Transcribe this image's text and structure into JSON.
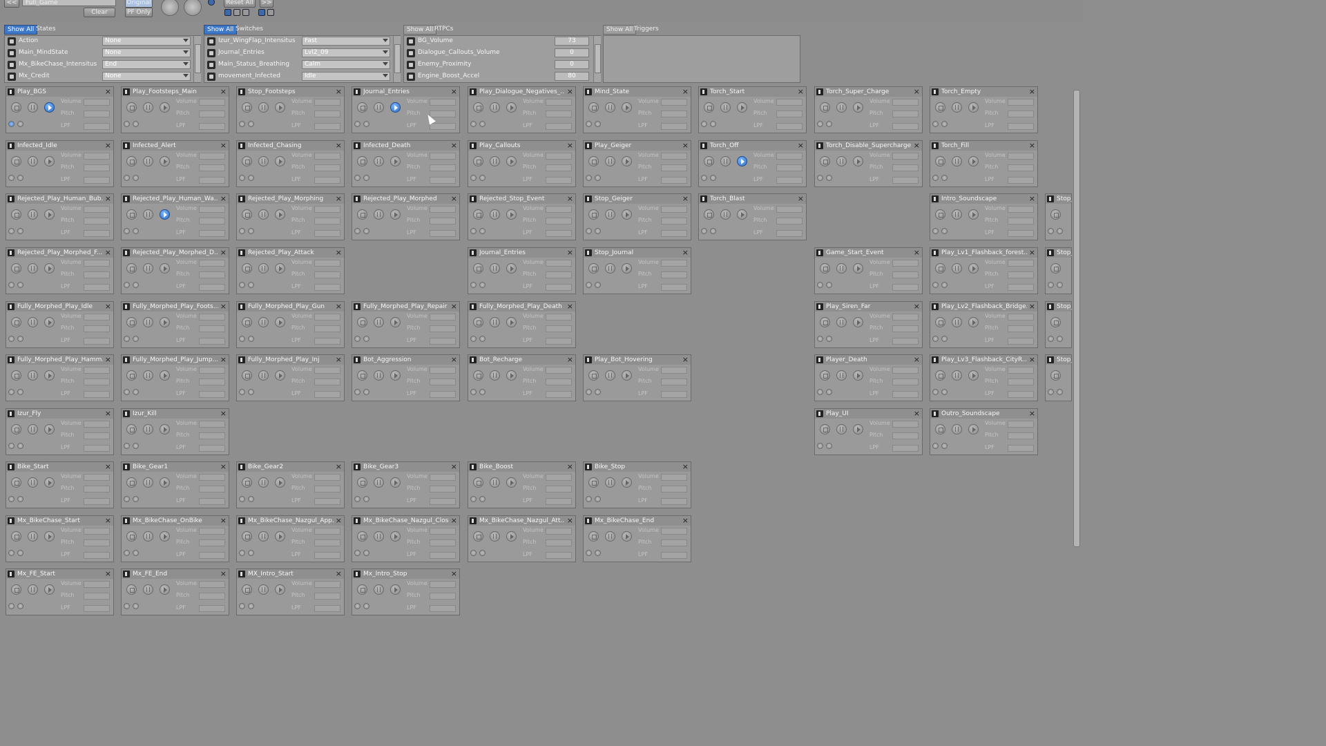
{
  "topbar": {
    "search_value": "Full_Game",
    "clear_label": "Clear",
    "original_label": "Original",
    "pf_only_label": "PF Only",
    "reset_all_label": "Reset All",
    "forward_label": ">>",
    "back_label": "<<"
  },
  "panels": [
    {
      "showall": "Show All",
      "tab": "States",
      "rows": [
        {
          "name": "Action",
          "value": "None"
        },
        {
          "name": "Main_MindState",
          "value": "None"
        },
        {
          "name": "Mx_BikeChase_Intensitus",
          "value": "End"
        },
        {
          "name": "Mx_Credit",
          "value": "None"
        }
      ]
    },
    {
      "showall": "Show All",
      "tab": "Switches",
      "rows": [
        {
          "name": "Izur_WingFlap_Intensitus",
          "value": "Fast"
        },
        {
          "name": "Journal_Entries",
          "value": "Lvl2_09"
        },
        {
          "name": "Main_Status_Breathing",
          "value": "Calm"
        },
        {
          "name": "movement_Infected",
          "value": "Idle"
        }
      ]
    },
    {
      "showall": "Show All",
      "tab": "RTPCs",
      "rows": [
        {
          "name": "BG_Volume",
          "value": "73"
        },
        {
          "name": "Dialogue_Callouts_Volume",
          "value": "0"
        },
        {
          "name": "Enemy_Proximity",
          "value": "0"
        },
        {
          "name": "Engine_Boost_Accel",
          "value": "80"
        }
      ]
    },
    {
      "showall": "Show All",
      "tab": "Triggers",
      "rows": []
    }
  ],
  "card_labels": {
    "volume": "Volume",
    "pitch": "Pitch",
    "lpf": "LPF"
  },
  "cards": [
    {
      "title": "Play_BGS",
      "active": true
    },
    {
      "title": "Play_Footsteps_Main",
      "active": false
    },
    {
      "title": "Stop_Footsteps",
      "active": false
    },
    {
      "title": "Journal_Entries",
      "active": true
    },
    {
      "title": "Play_Dialogue_Negatives_...",
      "active": false
    },
    {
      "title": "Mind_State",
      "active": false
    },
    {
      "title": "Torch_Start",
      "active": false
    },
    {
      "title": "Torch_Super_Charge",
      "active": false
    },
    {
      "title": "Torch_Empty",
      "active": false
    },
    {
      "title": "Infected_Idle",
      "active": false
    },
    {
      "title": "Infected_Alert",
      "active": false
    },
    {
      "title": "Infected_Chasing",
      "active": false
    },
    {
      "title": "Infected_Death",
      "active": false
    },
    {
      "title": "Play_Callouts",
      "active": false
    },
    {
      "title": "Play_Geiger",
      "active": false
    },
    {
      "title": "Torch_Off",
      "active": true
    },
    {
      "title": "Torch_Disable_Supercharge",
      "active": false
    },
    {
      "title": "Torch_Fill",
      "active": false
    },
    {
      "title": "Rejected_Play_Human_Bub...",
      "active": false
    },
    {
      "title": "Rejected_Play_Human_Wa...",
      "active": true
    },
    {
      "title": "Rejected_Play_Morphing",
      "active": false
    },
    {
      "title": "Rejected_Play_Morphed",
      "active": false
    },
    {
      "title": "Rejected_Stop_Event",
      "active": false
    },
    {
      "title": "Stop_Geiger",
      "active": false
    },
    {
      "title": "Torch_Blast",
      "active": false
    },
    {
      "title": "Intro_Soundscape",
      "active": false
    },
    {
      "title": "Stop_",
      "active": false
    },
    {
      "title": "Rejected_Play_Morphed_F...",
      "active": false
    },
    {
      "title": "Rejected_Play_Morphed_D...",
      "active": false
    },
    {
      "title": "Rejected_Play_Attack",
      "active": false
    },
    {
      "title": "Journal_Entries",
      "active": false
    },
    {
      "title": "Stop_Journal",
      "active": false
    },
    {
      "title": "Game_Start_Event",
      "active": false
    },
    {
      "title": "Play_Lv1_Flashback_forest...",
      "active": false
    },
    {
      "title": "Stop_",
      "active": false
    },
    {
      "title": "Fully_Morphed_Play_Idle",
      "active": false
    },
    {
      "title": "Fully_Morphed_Play_Foots...",
      "active": false
    },
    {
      "title": "Fully_Morphed_Play_Gun",
      "active": false
    },
    {
      "title": "Fully_Morphed_Play_Repair",
      "active": false
    },
    {
      "title": "Fully_Morphed_Play_Death",
      "active": false
    },
    {
      "title": "Play_Siren_Far",
      "active": false
    },
    {
      "title": "Play_Lv2_Flashback_Bridge...",
      "active": false
    },
    {
      "title": "Stop_",
      "active": false
    },
    {
      "title": "Fully_Morphed_Play_Hamm...",
      "active": false
    },
    {
      "title": "Fully_Morphed_Play_Jump...",
      "active": false
    },
    {
      "title": "Fully_Morphed_Play_Inj",
      "active": false
    },
    {
      "title": "Bot_Aggression",
      "active": false
    },
    {
      "title": "Bot_Recharge",
      "active": false
    },
    {
      "title": "Play_Bot_Hovering",
      "active": false
    },
    {
      "title": "Player_Death",
      "active": false
    },
    {
      "title": "Play_Lv3_Flashback_CityR...",
      "active": false
    },
    {
      "title": "Stop_",
      "active": false
    },
    {
      "title": "Izur_Fly",
      "active": false
    },
    {
      "title": "Izur_Kill",
      "active": false
    },
    {
      "title": "Play_UI",
      "active": false
    },
    {
      "title": "Outro_Soundscape",
      "active": false
    },
    {
      "title": "Bike_Start",
      "active": false
    },
    {
      "title": "Bike_Gear1",
      "active": false
    },
    {
      "title": "Bike_Gear2",
      "active": false
    },
    {
      "title": "Bike_Gear3",
      "active": false
    },
    {
      "title": "Bike_Boost",
      "active": false
    },
    {
      "title": "Bike_Stop",
      "active": false
    },
    {
      "title": "Mx_BikeChase_Start",
      "active": false
    },
    {
      "title": "Mx_BikeChase_OnBike",
      "active": false
    },
    {
      "title": "Mx_BikeChase_Nazgul_App...",
      "active": false
    },
    {
      "title": "Mx_BikeChase_Nazgul_Closer",
      "active": false
    },
    {
      "title": "Mx_BikeChase_Nazgul_Att...",
      "active": false
    },
    {
      "title": "Mx_BikeChase_End",
      "active": false
    },
    {
      "title": "Mx_FE_Start",
      "active": false
    },
    {
      "title": "Mx_FE_End",
      "active": false
    },
    {
      "title": "MX_Intro_Start",
      "active": false
    },
    {
      "title": "Mx_Intro_Stop",
      "active": false
    }
  ]
}
